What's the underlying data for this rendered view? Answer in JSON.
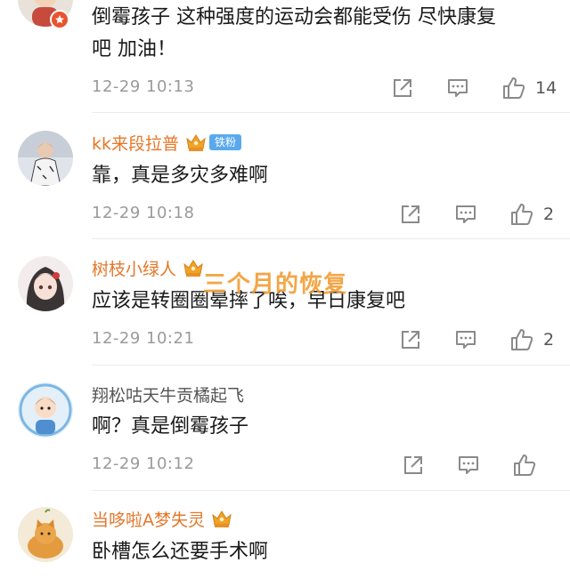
{
  "comments": [
    {
      "username": "",
      "text": "倒霉孩子 这种强度的运动会都能受伤 尽快康复\n吧 加油！",
      "time": "12-29 10:13",
      "likes": "14",
      "avatar_icon": "cartoon-avatar-icon"
    },
    {
      "username": "kk来段拉普",
      "fan_badge": "铁粉",
      "text": "靠，真是多灾多难啊",
      "time": "12-29 10:18",
      "likes": "2",
      "avatar_icon": "person-photo-avatar-icon"
    },
    {
      "username": "树枝小绿人",
      "text": "应该是转圈圈晕摔了唉，早日康复吧",
      "time": "12-29 10:21",
      "likes": "2",
      "avatar_icon": "anime-girl-avatar-icon"
    },
    {
      "username": "翔松咕天牛贡橘起飞",
      "text": "啊？真是倒霉孩子",
      "time": "12-29 10:12",
      "likes": "",
      "avatar_icon": "cartoon-boy-avatar-icon"
    },
    {
      "username": "当哆啦A梦失灵",
      "text": "卧槽怎么还要手术啊",
      "time": "",
      "likes": "",
      "avatar_icon": "orange-cat-avatar-icon"
    }
  ],
  "overlay_text": "三个月的恢复",
  "colors": {
    "username_vip": "#e5772a",
    "username_regular": "#555555",
    "fan_badge": "#5aa9ef",
    "timestamp": "#9a9a9a",
    "icon": "#8a8a8a",
    "overlay": "#f29a2e"
  }
}
